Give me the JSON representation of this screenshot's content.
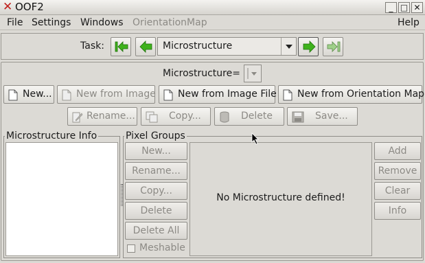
{
  "window": {
    "title": "OOF2",
    "controls": [
      "_",
      "□",
      "✕"
    ]
  },
  "menubar": {
    "items": [
      "File",
      "Settings",
      "Windows",
      "OrientationMap"
    ],
    "help": "Help"
  },
  "taskbar": {
    "label": "Task:",
    "selected_task": "Microstructure"
  },
  "microstructure": {
    "selector_label": "Microstructure=",
    "buttons_row1": [
      "New...",
      "New from Image",
      "New from Image File",
      "New from Orientation Map"
    ],
    "buttons_row2": [
      "Rename...",
      "Copy...",
      "Delete",
      "Save..."
    ]
  },
  "info_panel": {
    "title": "Microstructure Info"
  },
  "pixel_groups": {
    "title": "Pixel Groups",
    "left_buttons": [
      "New...",
      "Rename...",
      "Copy...",
      "Delete",
      "Delete All"
    ],
    "meshable_label": "Meshable",
    "message": "No Microstructure defined!",
    "right_buttons": [
      "Add",
      "Remove",
      "Clear",
      "Info"
    ]
  },
  "colors": {
    "accent_green": "#3fb21c",
    "close_red": "#c0201c",
    "background": "#dcdad5"
  }
}
